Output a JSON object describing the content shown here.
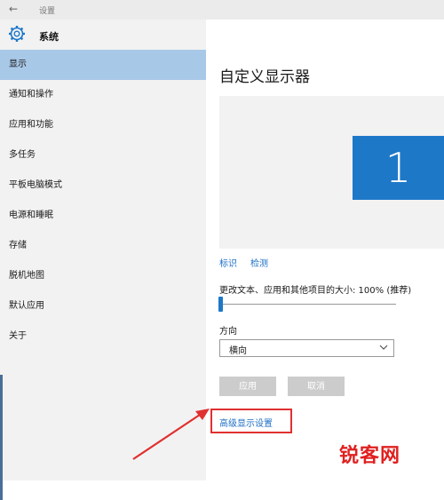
{
  "window": {
    "title": "设置"
  },
  "sidebar": {
    "header_label": "系统",
    "items": [
      {
        "label": "显示",
        "active": true
      },
      {
        "label": "通知和操作"
      },
      {
        "label": "应用和功能"
      },
      {
        "label": "多任务"
      },
      {
        "label": "平板电脑模式"
      },
      {
        "label": "电源和睡眠"
      },
      {
        "label": "存储"
      },
      {
        "label": "脱机地图"
      },
      {
        "label": "默认应用"
      },
      {
        "label": "关于"
      }
    ]
  },
  "main": {
    "title": "自定义显示器",
    "monitor_number": "1",
    "identify_link": "标识",
    "detect_link": "检测",
    "scale_label": "更改文本、应用和其他项目的大小: 100% (推荐)",
    "scale_percent": 100,
    "orientation_label": "方向",
    "orientation_value": "横向",
    "apply_button": "应用",
    "cancel_button": "取消",
    "advanced_link": "高级显示设置"
  },
  "watermark": {
    "text": "锐客网"
  },
  "colors": {
    "accent": "#1e78c8",
    "active_item": "#a8c8e8",
    "annotation": "#e03030",
    "link": "#1e6fc5"
  }
}
